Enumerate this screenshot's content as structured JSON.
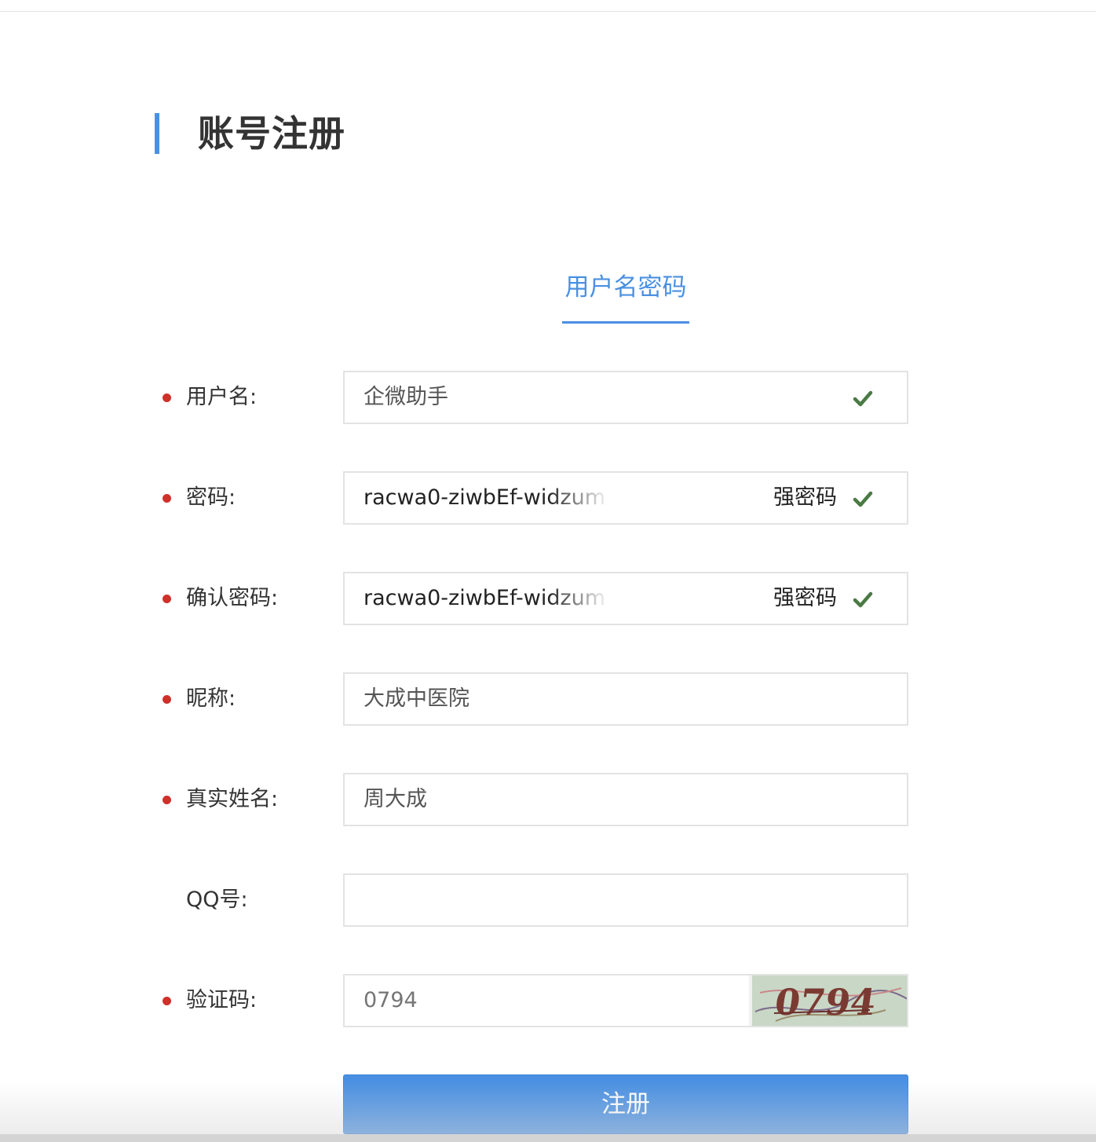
{
  "header": {
    "title": "账号注册"
  },
  "tabs": [
    {
      "label": "用户名密码",
      "active": true
    }
  ],
  "form": {
    "username": {
      "label": "用户名:",
      "value": "企微助手",
      "required": true,
      "valid": true
    },
    "password": {
      "label": "密码:",
      "value": "racwa0-ziwbEf-widzum",
      "strength": "强密码",
      "required": true,
      "valid": true
    },
    "confirm_password": {
      "label": "确认密码:",
      "value": "racwa0-ziwbEf-widzum",
      "strength": "强密码",
      "required": true,
      "valid": true
    },
    "nickname": {
      "label": "昵称:",
      "value": "大成中医院",
      "required": true
    },
    "real_name": {
      "label": "真实姓名:",
      "value": "周大成",
      "required": true
    },
    "qq": {
      "label": "QQ号:",
      "value": "",
      "required": false
    },
    "captcha": {
      "label": "验证码:",
      "placeholder": "0794",
      "value": "",
      "image_text": "0794",
      "required": true
    }
  },
  "submit": {
    "label": "注册"
  },
  "colors": {
    "accent": "#4a90e2",
    "required_dot": "#d0302a",
    "valid_check": "#4a7a44"
  }
}
